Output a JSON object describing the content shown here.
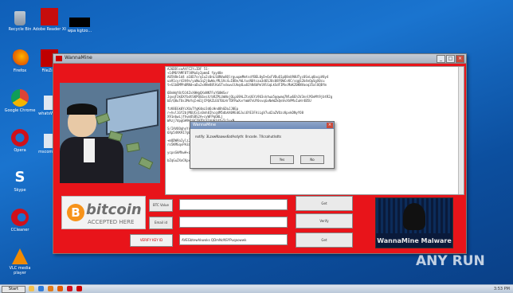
{
  "desktop": {
    "icons": [
      {
        "label": "Recycle Bin"
      },
      {
        "label": "Adobe Reader XI"
      },
      {
        "label": "wpa kgtzo..."
      },
      {
        "label": "Firefox"
      },
      {
        "label": "FileZilla"
      },
      {
        "label": "Google Chrome"
      },
      {
        "label": "whatsWh..."
      },
      {
        "label": "Opera"
      },
      {
        "label": "mscomm..."
      },
      {
        "label": "Skype"
      },
      {
        "label": "CCleaner"
      },
      {
        "label": "VLC media player"
      }
    ]
  },
  "window": {
    "title": "WannaMine",
    "text_lines": [
      "A26DDlcuAtFC2Y=IDF 51-",
      "+14M6fAMF8TlKMuUy2pmmE fpyd8e",
      "A05V0n1d4 a1UD7o/q1u2c0nLSUNVw8QlrguupmMmtsdfBEL0yD+6xFVDuQ1pQ8nU90UTyc0SnLq8acpV8y4",
      "ua91cyr43h9n/yaNw1q2j0wWx/MLSVc4=I8Be/WLtusN0tcaa3d6SJ0c08Y0WCsKC/sqgS2b4nOpSgX0cu",
      "t+G1bOMPh0RNd+aDu2xANe88lKaSTvdxwulUkqdLwOJhN4bPmlNlGqLkSdFIMxcMaKZ0KNVaoq35alUQBfm",
      "",
      "6BnWqY8/DJ4ZvXHHgQXoNN7FuY60WSxr",
      "JqvqF3kOXfbdtSKPQG6vsX/bRZPLUmNojQLpG9ALZtxUGYz9U3sktwa5qqwmq7Nlw6Eh1V3nnlM3eMt9jbtR2g",
      "bD/Q8uTOs3MoYqI+W1jCPQAZLE6T0LHrTDFRwXvrhmW7nUY0svqGxNeWZkQeVvXhPMxIuHr4B5U",
      "",
      "fzK8EGk0YcXUuTYgK4mz3d6cHnd8hGDaJJ0Ep",
      "r+hvl1GY2bjM6UCo1s0nh8Ihcq4M5dbAX09Ed6Jui6YE3FAiLgV7ud2aZVOzcKpvkDNyYO8",
      "X91ebwLjfhvmOSBS2A+cyWFPqQ0Lj",
      "WAzj7dpgGH9Hl9CZ9ZDiYlhUAt4fvTc1uxN",
      "",
      "S/IAVOOqhoYrbJeJ5vlAlm9n+P8t2pQAXEfB19cyL2dekB14BZoVWt3ydqpHsL4qXmnuwqXcMkBuxk",
      "6Xp54VK9I7g0g6gMGxtuWa/4zafPK/LBW3RSNRkt9d+VkOzpV/hHfnUnoZdpRaXmrdXwJ4WZ3Wx5Q2m6EaV",
      "",
      "+mQDW9aIylzJM0Lz3HR3kEg+0Xh2d8gBL1QMsBo0gl2W0ACWzYZ0JvC7y24mD0p",
      "ro5KMGqvPA3a0MHzjtHaW5iZwqgd4QUGu53Ue",
      "",
      "ycpsGkMhwH+zpNk8etLcPFNE/5XMqdAmWYR0E6y",
      "",
      "bZqGuZXoCKpxXT1lrjyqk02V1Ym3GhV+0bqdE6Gjs"
    ],
    "dialog": {
      "title": "WannaMine",
      "message": "notify: 3LzxwNaawx6atAsdyth: 0ncode. 7Xcsahutlsdts",
      "yes_label": "Yes",
      "no_label": "No"
    },
    "bitcoin": {
      "word": "bitcoin",
      "accepted": "ACCEPTED HERE",
      "coin_symbol": "B"
    },
    "payment": [
      {
        "label": "BTC Value",
        "value": "",
        "action": "Get"
      },
      {
        "label": "Email id",
        "value": "",
        "action": "Verify"
      },
      {
        "label": "VERIFY KEY ID",
        "value": "AVEGbtewhkwoks QDmNcNSYPuqaowwk",
        "action": "Get"
      }
    ],
    "malware_banner": "WannaMine Malware"
  },
  "watermark": "ANY RUN",
  "taskbar": {
    "start_label": "Start",
    "clock": "3:53 PM"
  }
}
